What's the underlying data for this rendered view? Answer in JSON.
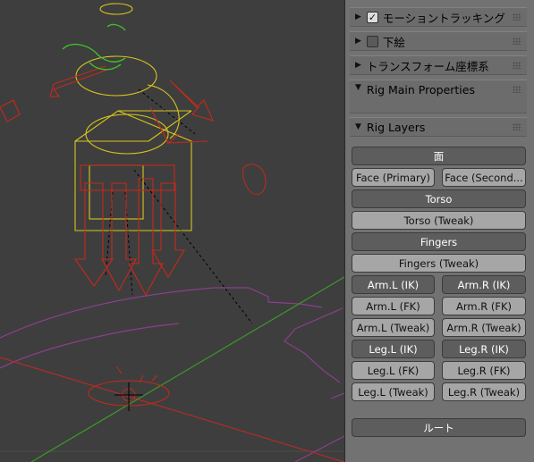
{
  "panels": [
    {
      "label": "モーショントラッキング",
      "expanded": false,
      "checkbox": true,
      "checked": true
    },
    {
      "label": "下絵",
      "expanded": false,
      "checkbox": true,
      "checked": false
    },
    {
      "label": "トランスフォーム座標系",
      "expanded": false,
      "checkbox": false
    },
    {
      "label": "Rig Main Properties",
      "expanded": true,
      "checkbox": false
    },
    {
      "label": "Rig Layers",
      "expanded": true,
      "checkbox": false
    }
  ],
  "layers": {
    "face": {
      "label": "面",
      "active": true
    },
    "face_primary": {
      "label": "Face (Primary)",
      "active": false
    },
    "face_secondary": {
      "label": "Face (Second...",
      "active": false
    },
    "torso": {
      "label": "Torso",
      "active": true
    },
    "torso_tweak": {
      "label": "Torso (Tweak)",
      "active": false
    },
    "fingers": {
      "label": "Fingers",
      "active": true
    },
    "fingers_tweak": {
      "label": "Fingers (Tweak)",
      "active": false
    },
    "arm_l_ik": {
      "label": "Arm.L (IK)",
      "active": true
    },
    "arm_r_ik": {
      "label": "Arm.R (IK)",
      "active": true
    },
    "arm_l_fk": {
      "label": "Arm.L (FK)",
      "active": false
    },
    "arm_r_fk": {
      "label": "Arm.R (FK)",
      "active": false
    },
    "arm_l_tweak": {
      "label": "Arm.L (Tweak)",
      "active": false
    },
    "arm_r_tweak": {
      "label": "Arm.R (Tweak)",
      "active": false
    },
    "leg_l_ik": {
      "label": "Leg.L (IK)",
      "active": true
    },
    "leg_r_ik": {
      "label": "Leg.R (IK)",
      "active": true
    },
    "leg_l_fk": {
      "label": "Leg.L (FK)",
      "active": false
    },
    "leg_r_fk": {
      "label": "Leg.R (FK)",
      "active": false
    },
    "leg_l_tweak": {
      "label": "Leg.L (Tweak)",
      "active": false
    },
    "leg_r_tweak": {
      "label": "Leg.R (Tweak)",
      "active": false
    },
    "root": {
      "label": "ルート",
      "active": true
    }
  },
  "colors": {
    "viewport_bg": "#3d3d3d",
    "panel_bg": "#727272",
    "button_active": "#5d5d5d",
    "button_inactive": "#a6a6a6",
    "rig_red": "#c42a1a",
    "rig_yellow": "#d8c51e",
    "rig_green": "#3fbf2a",
    "axis_red": "#b32a2a",
    "axis_green": "#3a9a2a",
    "mesh_purple": "#8a3f8a"
  }
}
